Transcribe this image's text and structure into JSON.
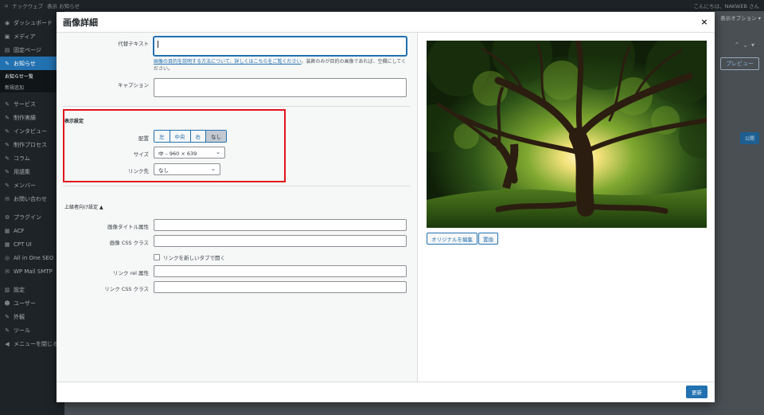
{
  "adminbar": {
    "site": "ナックウェブ",
    "view": "表示 お知らせ",
    "greeting": "こんにちは、NAKWEB さん"
  },
  "sidebar": {
    "items": [
      {
        "icon": "dashboard-icon",
        "glyph": "◉",
        "label": "ダッシュボード"
      },
      {
        "icon": "media-icon",
        "glyph": "▣",
        "label": "メディア"
      },
      {
        "icon": "page-icon",
        "glyph": "▤",
        "label": "固定ページ"
      },
      {
        "icon": "pin-icon",
        "glyph": "✎",
        "label": "お知らせ",
        "active": true
      }
    ],
    "subitems": [
      "お知らせ一覧",
      "新規追加"
    ],
    "items2": [
      {
        "icon": "pin-icon",
        "glyph": "✎",
        "label": "サービス"
      },
      {
        "icon": "pin-icon",
        "glyph": "✎",
        "label": "制作実績"
      },
      {
        "icon": "pin-icon",
        "glyph": "✎",
        "label": "インタビュー"
      },
      {
        "icon": "pin-icon",
        "glyph": "✎",
        "label": "制作プロセス"
      },
      {
        "icon": "pin-icon",
        "glyph": "✎",
        "label": "コラム"
      },
      {
        "icon": "pin-icon",
        "glyph": "✎",
        "label": "用語集"
      },
      {
        "icon": "pin-icon",
        "glyph": "✎",
        "label": "メンバー"
      },
      {
        "icon": "mail-icon",
        "glyph": "✉",
        "label": "お問い合わせ"
      }
    ],
    "items3": [
      {
        "icon": "plugin-icon",
        "glyph": "⚙",
        "label": "プラグイン"
      },
      {
        "icon": "grid-icon",
        "glyph": "▦",
        "label": "ACF"
      },
      {
        "icon": "grid-icon",
        "glyph": "▦",
        "label": "CPT UI"
      },
      {
        "icon": "seo-icon",
        "glyph": "◎",
        "label": "All in One SEO"
      },
      {
        "icon": "mail-icon",
        "glyph": "✉",
        "label": "WP Mail SMTP"
      }
    ],
    "items4": [
      {
        "icon": "settings-icon",
        "glyph": "▥",
        "label": "設定"
      },
      {
        "icon": "user-icon",
        "glyph": "☻",
        "label": "ユーザー"
      },
      {
        "icon": "appearance-icon",
        "glyph": "✎",
        "label": "外観"
      },
      {
        "icon": "tools-icon",
        "glyph": "✎",
        "label": "ツール"
      },
      {
        "icon": "collapse-icon",
        "glyph": "◀",
        "label": "メニューを閉じる"
      }
    ]
  },
  "page": {
    "options": "表示オプション ▾",
    "preview": "プレビュー",
    "publish": "公開"
  },
  "modal": {
    "title": "画像詳細",
    "close": "×",
    "alt_label": "代替テキスト",
    "help_link": "画像の目的を説明する方法について、詳しくはこちらをご覧ください",
    "help_rest": "。装飾のみが目的の画像であれば、空欄にしてください。",
    "caption_label": "キャプション",
    "display_title": "表示設定",
    "align_label": "配置",
    "align_options": [
      "左",
      "中央",
      "右",
      "なし"
    ],
    "size_label": "サイズ",
    "size_value": "中 – 960 × 639",
    "link_label": "リンク先",
    "link_value": "なし",
    "advanced_title": "上級者向け設定",
    "advanced_arrow": "▲",
    "img_title_label": "画像タイトル属性",
    "img_css_label": "画像 CSS クラス",
    "newtab_label": "リンクを新しいタブで開く",
    "rel_label": "リンク rel 属性",
    "link_css_label": "リンク CSS クラス",
    "edit_original": "オリジナルを編集",
    "replace": "置換",
    "update": "更新"
  }
}
